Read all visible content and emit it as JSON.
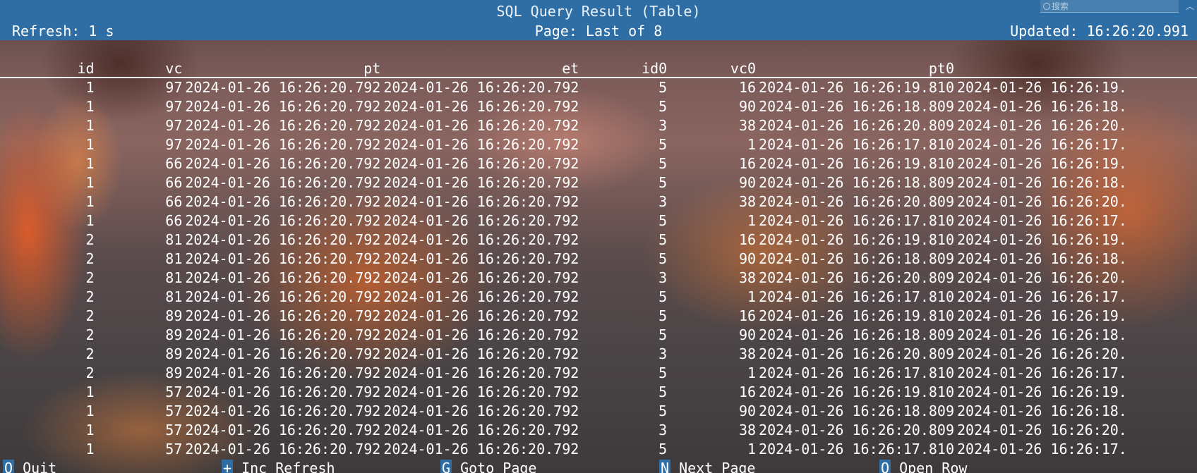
{
  "title": "SQL Query Result (Table)",
  "status": {
    "refresh": "Refresh: 1 s",
    "page": "Page: Last of 8",
    "updated": "Updated: 16:26:20.991"
  },
  "search": {
    "placeholder": "搜索"
  },
  "colors": {
    "titlebar": "#2e6ea4",
    "key_bg": "#2e6ea4",
    "text": "#ffffff"
  },
  "table": {
    "columns": [
      "id",
      "vc",
      "pt",
      "et",
      "id0",
      "vc0",
      "pt0"
    ],
    "rows": [
      [
        "1",
        "97",
        "2024-01-26 16:26:20.792",
        "2024-01-26 16:26:20.792",
        "5",
        "16",
        "2024-01-26 16:26:19.810",
        "2024-01-26 16:26:19."
      ],
      [
        "1",
        "97",
        "2024-01-26 16:26:20.792",
        "2024-01-26 16:26:20.792",
        "5",
        "90",
        "2024-01-26 16:26:18.809",
        "2024-01-26 16:26:18."
      ],
      [
        "1",
        "97",
        "2024-01-26 16:26:20.792",
        "2024-01-26 16:26:20.792",
        "3",
        "38",
        "2024-01-26 16:26:20.809",
        "2024-01-26 16:26:20."
      ],
      [
        "1",
        "97",
        "2024-01-26 16:26:20.792",
        "2024-01-26 16:26:20.792",
        "5",
        "1",
        "2024-01-26 16:26:17.810",
        "2024-01-26 16:26:17."
      ],
      [
        "1",
        "66",
        "2024-01-26 16:26:20.792",
        "2024-01-26 16:26:20.792",
        "5",
        "16",
        "2024-01-26 16:26:19.810",
        "2024-01-26 16:26:19."
      ],
      [
        "1",
        "66",
        "2024-01-26 16:26:20.792",
        "2024-01-26 16:26:20.792",
        "5",
        "90",
        "2024-01-26 16:26:18.809",
        "2024-01-26 16:26:18."
      ],
      [
        "1",
        "66",
        "2024-01-26 16:26:20.792",
        "2024-01-26 16:26:20.792",
        "3",
        "38",
        "2024-01-26 16:26:20.809",
        "2024-01-26 16:26:20."
      ],
      [
        "1",
        "66",
        "2024-01-26 16:26:20.792",
        "2024-01-26 16:26:20.792",
        "5",
        "1",
        "2024-01-26 16:26:17.810",
        "2024-01-26 16:26:17."
      ],
      [
        "2",
        "81",
        "2024-01-26 16:26:20.792",
        "2024-01-26 16:26:20.792",
        "5",
        "16",
        "2024-01-26 16:26:19.810",
        "2024-01-26 16:26:19."
      ],
      [
        "2",
        "81",
        "2024-01-26 16:26:20.792",
        "2024-01-26 16:26:20.792",
        "5",
        "90",
        "2024-01-26 16:26:18.809",
        "2024-01-26 16:26:18."
      ],
      [
        "2",
        "81",
        "2024-01-26 16:26:20.792",
        "2024-01-26 16:26:20.792",
        "3",
        "38",
        "2024-01-26 16:26:20.809",
        "2024-01-26 16:26:20."
      ],
      [
        "2",
        "81",
        "2024-01-26 16:26:20.792",
        "2024-01-26 16:26:20.792",
        "5",
        "1",
        "2024-01-26 16:26:17.810",
        "2024-01-26 16:26:17."
      ],
      [
        "2",
        "89",
        "2024-01-26 16:26:20.792",
        "2024-01-26 16:26:20.792",
        "5",
        "16",
        "2024-01-26 16:26:19.810",
        "2024-01-26 16:26:19."
      ],
      [
        "2",
        "89",
        "2024-01-26 16:26:20.792",
        "2024-01-26 16:26:20.792",
        "5",
        "90",
        "2024-01-26 16:26:18.809",
        "2024-01-26 16:26:18."
      ],
      [
        "2",
        "89",
        "2024-01-26 16:26:20.792",
        "2024-01-26 16:26:20.792",
        "3",
        "38",
        "2024-01-26 16:26:20.809",
        "2024-01-26 16:26:20."
      ],
      [
        "2",
        "89",
        "2024-01-26 16:26:20.792",
        "2024-01-26 16:26:20.792",
        "5",
        "1",
        "2024-01-26 16:26:17.810",
        "2024-01-26 16:26:17."
      ],
      [
        "1",
        "57",
        "2024-01-26 16:26:20.792",
        "2024-01-26 16:26:20.792",
        "5",
        "16",
        "2024-01-26 16:26:19.810",
        "2024-01-26 16:26:19."
      ],
      [
        "1",
        "57",
        "2024-01-26 16:26:20.792",
        "2024-01-26 16:26:20.792",
        "5",
        "90",
        "2024-01-26 16:26:18.809",
        "2024-01-26 16:26:18."
      ],
      [
        "1",
        "57",
        "2024-01-26 16:26:20.792",
        "2024-01-26 16:26:20.792",
        "3",
        "38",
        "2024-01-26 16:26:20.809",
        "2024-01-26 16:26:20."
      ],
      [
        "1",
        "57",
        "2024-01-26 16:26:20.792",
        "2024-01-26 16:26:20.792",
        "5",
        "1",
        "2024-01-26 16:26:17.810",
        "2024-01-26 16:26:17."
      ]
    ]
  },
  "footer": {
    "keys": [
      {
        "key": "Q",
        "label": "Quit"
      },
      {
        "key": "+",
        "label": "Inc Refresh"
      },
      {
        "key": "G",
        "label": "Goto Page"
      },
      {
        "key": "N",
        "label": "Next Page"
      },
      {
        "key": "O",
        "label": "Open Row"
      }
    ]
  }
}
